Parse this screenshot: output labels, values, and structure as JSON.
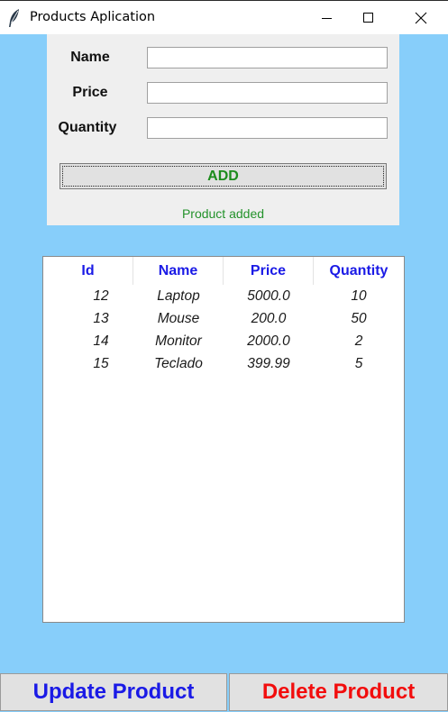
{
  "window": {
    "title": "Products Aplication"
  },
  "form": {
    "name_label": "Name",
    "price_label": "Price",
    "quantity_label": "Quantity",
    "name_value": "",
    "price_value": "",
    "quantity_value": "",
    "add_label": "ADD",
    "status": "Product added"
  },
  "table": {
    "columns": [
      "Id",
      "Name",
      "Price",
      "Quantity"
    ],
    "rows": [
      [
        "12",
        "Laptop",
        "5000.0",
        "10"
      ],
      [
        "13",
        "Mouse",
        "200.0",
        "50"
      ],
      [
        "14",
        "Monitor",
        "2000.0",
        "2"
      ],
      [
        "15",
        "Teclado",
        "399.99",
        "5"
      ]
    ]
  },
  "actions": {
    "update_label": "Update Product",
    "delete_label": "Delete Product"
  },
  "colors": {
    "background": "#87cefa",
    "header_text": "#1a1ae6",
    "add_text": "#1d8c1d",
    "status_text": "#23922b",
    "update_text": "#1a1ae6",
    "delete_text": "#f20d0d"
  },
  "icons": [
    "feather-icon",
    "minimize-icon",
    "maximize-icon",
    "close-icon"
  ]
}
